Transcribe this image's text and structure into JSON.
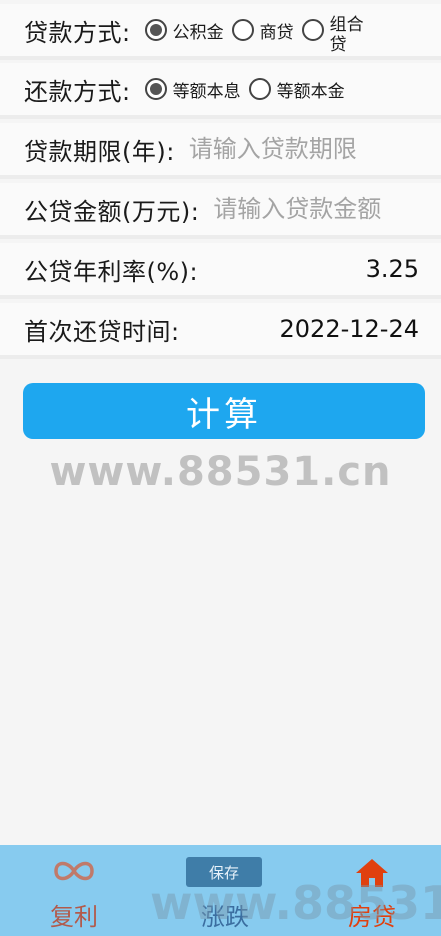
{
  "form": {
    "loan_type": {
      "label": "贷款方式:",
      "options": [
        "公积金",
        "商贷",
        "组合贷"
      ],
      "selected": "公积金"
    },
    "repay_method": {
      "label": "还款方式:",
      "options": [
        "等额本息",
        "等额本金"
      ],
      "selected": "等额本息"
    },
    "term": {
      "label": "贷款期限(年):",
      "placeholder": "请输入贷款期限"
    },
    "amount": {
      "label": "公贷金额(万元):",
      "placeholder": "请输入贷款金额"
    },
    "rate": {
      "label": "公贷年利率(%):",
      "value": "3.25"
    },
    "first_date": {
      "label": "首次还贷时间:",
      "value": "2022-12-24"
    }
  },
  "calc_button": {
    "label": "计算",
    "color": "#1ea7ef"
  },
  "watermark": "www.88531.cn",
  "save_chip": "保存",
  "tabs": {
    "fuli": {
      "label": "复利",
      "icon": "infinity-icon"
    },
    "zhangdie": {
      "label": "涨跌",
      "icon": "chart-icon"
    },
    "fangdai": {
      "label": "房贷",
      "icon": "house-icon",
      "active": true
    }
  },
  "colors": {
    "accent": "#1ea7ef",
    "tabbar": "#87cbef",
    "active_tab": "#e0400f"
  }
}
